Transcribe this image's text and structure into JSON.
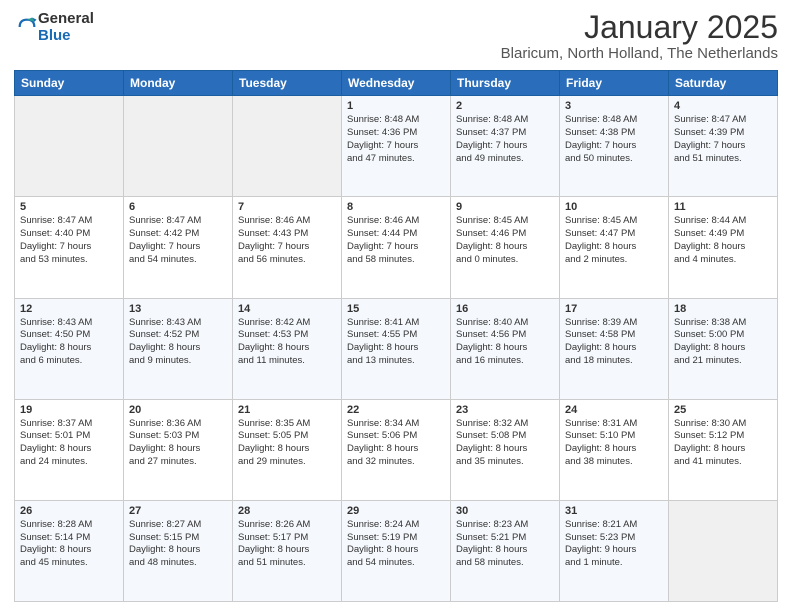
{
  "logo": {
    "general": "General",
    "blue": "Blue"
  },
  "header": {
    "month_year": "January 2025",
    "location": "Blaricum, North Holland, The Netherlands"
  },
  "weekdays": [
    "Sunday",
    "Monday",
    "Tuesday",
    "Wednesday",
    "Thursday",
    "Friday",
    "Saturday"
  ],
  "weeks": [
    [
      {
        "num": "",
        "info": ""
      },
      {
        "num": "",
        "info": ""
      },
      {
        "num": "",
        "info": ""
      },
      {
        "num": "1",
        "info": "Sunrise: 8:48 AM\nSunset: 4:36 PM\nDaylight: 7 hours\nand 47 minutes."
      },
      {
        "num": "2",
        "info": "Sunrise: 8:48 AM\nSunset: 4:37 PM\nDaylight: 7 hours\nand 49 minutes."
      },
      {
        "num": "3",
        "info": "Sunrise: 8:48 AM\nSunset: 4:38 PM\nDaylight: 7 hours\nand 50 minutes."
      },
      {
        "num": "4",
        "info": "Sunrise: 8:47 AM\nSunset: 4:39 PM\nDaylight: 7 hours\nand 51 minutes."
      }
    ],
    [
      {
        "num": "5",
        "info": "Sunrise: 8:47 AM\nSunset: 4:40 PM\nDaylight: 7 hours\nand 53 minutes."
      },
      {
        "num": "6",
        "info": "Sunrise: 8:47 AM\nSunset: 4:42 PM\nDaylight: 7 hours\nand 54 minutes."
      },
      {
        "num": "7",
        "info": "Sunrise: 8:46 AM\nSunset: 4:43 PM\nDaylight: 7 hours\nand 56 minutes."
      },
      {
        "num": "8",
        "info": "Sunrise: 8:46 AM\nSunset: 4:44 PM\nDaylight: 7 hours\nand 58 minutes."
      },
      {
        "num": "9",
        "info": "Sunrise: 8:45 AM\nSunset: 4:46 PM\nDaylight: 8 hours\nand 0 minutes."
      },
      {
        "num": "10",
        "info": "Sunrise: 8:45 AM\nSunset: 4:47 PM\nDaylight: 8 hours\nand 2 minutes."
      },
      {
        "num": "11",
        "info": "Sunrise: 8:44 AM\nSunset: 4:49 PM\nDaylight: 8 hours\nand 4 minutes."
      }
    ],
    [
      {
        "num": "12",
        "info": "Sunrise: 8:43 AM\nSunset: 4:50 PM\nDaylight: 8 hours\nand 6 minutes."
      },
      {
        "num": "13",
        "info": "Sunrise: 8:43 AM\nSunset: 4:52 PM\nDaylight: 8 hours\nand 9 minutes."
      },
      {
        "num": "14",
        "info": "Sunrise: 8:42 AM\nSunset: 4:53 PM\nDaylight: 8 hours\nand 11 minutes."
      },
      {
        "num": "15",
        "info": "Sunrise: 8:41 AM\nSunset: 4:55 PM\nDaylight: 8 hours\nand 13 minutes."
      },
      {
        "num": "16",
        "info": "Sunrise: 8:40 AM\nSunset: 4:56 PM\nDaylight: 8 hours\nand 16 minutes."
      },
      {
        "num": "17",
        "info": "Sunrise: 8:39 AM\nSunset: 4:58 PM\nDaylight: 8 hours\nand 18 minutes."
      },
      {
        "num": "18",
        "info": "Sunrise: 8:38 AM\nSunset: 5:00 PM\nDaylight: 8 hours\nand 21 minutes."
      }
    ],
    [
      {
        "num": "19",
        "info": "Sunrise: 8:37 AM\nSunset: 5:01 PM\nDaylight: 8 hours\nand 24 minutes."
      },
      {
        "num": "20",
        "info": "Sunrise: 8:36 AM\nSunset: 5:03 PM\nDaylight: 8 hours\nand 27 minutes."
      },
      {
        "num": "21",
        "info": "Sunrise: 8:35 AM\nSunset: 5:05 PM\nDaylight: 8 hours\nand 29 minutes."
      },
      {
        "num": "22",
        "info": "Sunrise: 8:34 AM\nSunset: 5:06 PM\nDaylight: 8 hours\nand 32 minutes."
      },
      {
        "num": "23",
        "info": "Sunrise: 8:32 AM\nSunset: 5:08 PM\nDaylight: 8 hours\nand 35 minutes."
      },
      {
        "num": "24",
        "info": "Sunrise: 8:31 AM\nSunset: 5:10 PM\nDaylight: 8 hours\nand 38 minutes."
      },
      {
        "num": "25",
        "info": "Sunrise: 8:30 AM\nSunset: 5:12 PM\nDaylight: 8 hours\nand 41 minutes."
      }
    ],
    [
      {
        "num": "26",
        "info": "Sunrise: 8:28 AM\nSunset: 5:14 PM\nDaylight: 8 hours\nand 45 minutes."
      },
      {
        "num": "27",
        "info": "Sunrise: 8:27 AM\nSunset: 5:15 PM\nDaylight: 8 hours\nand 48 minutes."
      },
      {
        "num": "28",
        "info": "Sunrise: 8:26 AM\nSunset: 5:17 PM\nDaylight: 8 hours\nand 51 minutes."
      },
      {
        "num": "29",
        "info": "Sunrise: 8:24 AM\nSunset: 5:19 PM\nDaylight: 8 hours\nand 54 minutes."
      },
      {
        "num": "30",
        "info": "Sunrise: 8:23 AM\nSunset: 5:21 PM\nDaylight: 8 hours\nand 58 minutes."
      },
      {
        "num": "31",
        "info": "Sunrise: 8:21 AM\nSunset: 5:23 PM\nDaylight: 9 hours\nand 1 minute."
      },
      {
        "num": "",
        "info": ""
      }
    ]
  ]
}
